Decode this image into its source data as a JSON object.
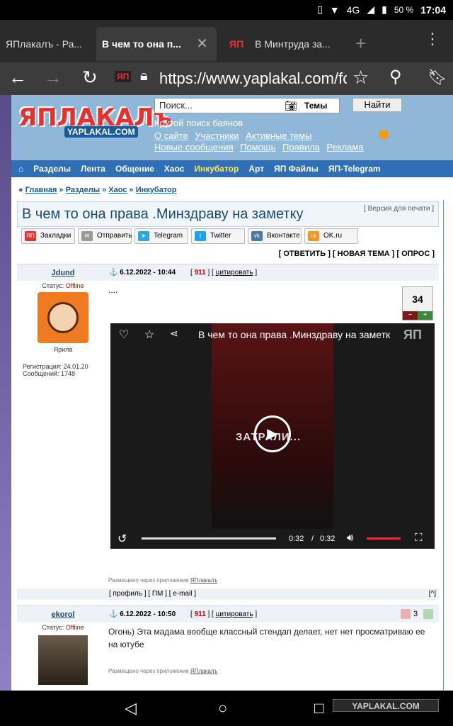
{
  "status": {
    "network": "4G",
    "battery": "50 %",
    "time": "17:04"
  },
  "tabs": [
    "ЯПлакалъ - Ра...",
    "В чем то она п...",
    "В Минтруда за..."
  ],
  "url": "https://www.yaplakal.com/foru",
  "site": {
    "logo": "ЯПЛАКАЛъ",
    "logo_sub": "YAPLAKAL.COM",
    "search_placeholder": "Поиск...",
    "search_scope": "Темы",
    "search_button": "Найти",
    "search_caption": "Крутой поиск баянов",
    "links_row1": [
      "О сайте",
      "Участники",
      "Активные темы"
    ],
    "links_row2": [
      "Новые сообщения",
      "Помощь",
      "Правила",
      "Реклама"
    ]
  },
  "menu": [
    "Разделы",
    "Лента",
    "Общение",
    "Хаос",
    "Инкубатор",
    "Арт",
    "ЯП Файлы",
    "ЯП-Telegram"
  ],
  "breadcrumbs": [
    "Главная",
    "Разделы",
    "Хаос",
    "Инкубатор"
  ],
  "topic": {
    "title": "В чем то она права .Минздраву на заметку",
    "print": "[ Версия для печати ]"
  },
  "share": [
    "Закладки",
    "Отправить",
    "Telegram",
    "Twitter",
    "Вконтакте",
    "OK.ru"
  ],
  "actions": "[ ОТВЕТИТЬ ] [ НОВАЯ ТЕМА ] [ ОПРОС ]",
  "post1": {
    "user": "Jdund",
    "date": "6.12.2022 - 10:44",
    "num": "911",
    "cite": "цитировать",
    "status_label": "Статус:",
    "status": "Offline",
    "rank": "Ярила",
    "reg": "Регистрация: 24.01.20",
    "msgs": "Сообщений: 1748",
    "text": "....",
    "rating": "34",
    "video_title": "В чем то она права .Минздраву на заметк",
    "video_overlay": "ЗАТРАЛИ...",
    "time_cur": "0:32",
    "time_total": "0:32",
    "via": "Размещено через приложение",
    "via_app": "ЯПлакалъ",
    "footer": "[ профиль ] [ ПМ ] [ e-mail ]"
  },
  "post2": {
    "user": "ekorol",
    "date": "6.12.2022 - 10:50",
    "num": "911",
    "cite": "цитировать",
    "status_label": "Статус:",
    "status": "Offline",
    "text": "Огонь) Эта мадама вообще классный стендап делает, нет нет просматриваю ее на ютубе",
    "rating": "3",
    "via": "Размещено через приложение",
    "via_app": "ЯПлакалъ"
  },
  "watermark": "YAPLAKAL.COM",
  "colors": {
    "header_bg": "#8fb8d8",
    "menu_bg": "#2e6fb5",
    "offline": "#cc0000",
    "logo": "#e83030"
  }
}
